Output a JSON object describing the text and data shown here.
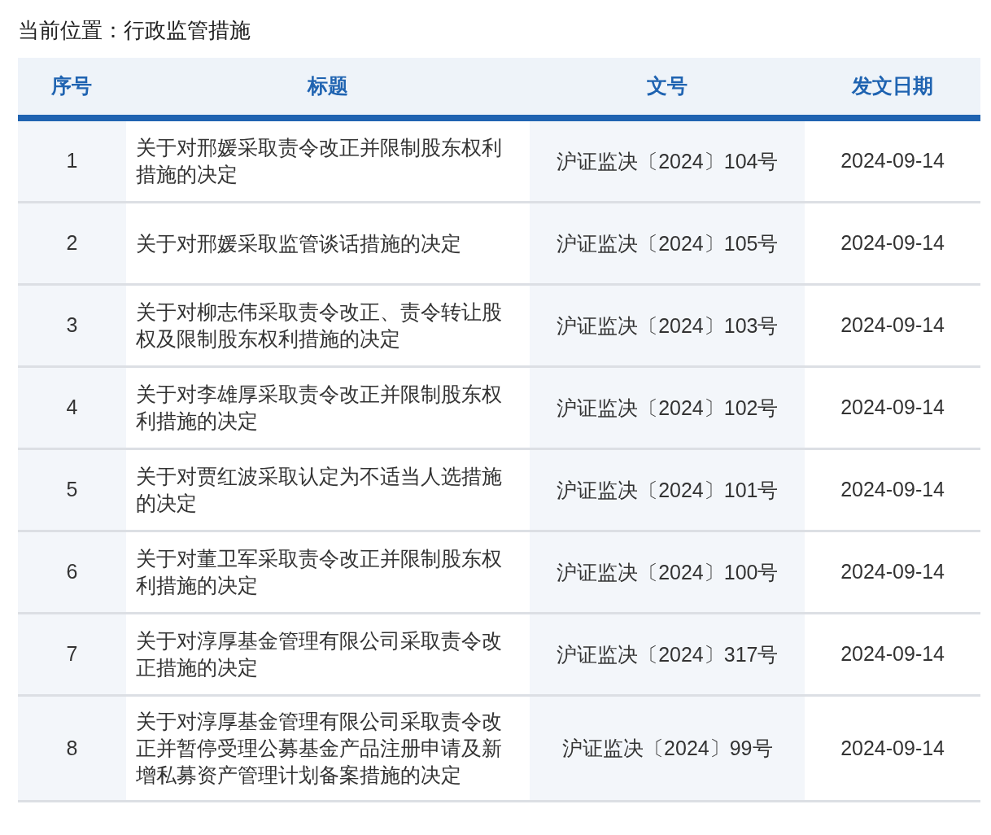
{
  "breadcrumb": "当前位置：行政监管措施",
  "table": {
    "columns": [
      "序号",
      "标题",
      "文号",
      "发文日期"
    ],
    "rows": [
      {
        "index": "1",
        "title": "关于对邢媛采取责令改正并限制股东权利措施的决定",
        "doc_no": "沪证监决〔2024〕104号",
        "date": "2024-09-14"
      },
      {
        "index": "2",
        "title": "关于对邢媛采取监管谈话措施的决定",
        "doc_no": "沪证监决〔2024〕105号",
        "date": "2024-09-14"
      },
      {
        "index": "3",
        "title": "关于对柳志伟采取责令改正、责令转让股权及限制股东权利措施的决定",
        "doc_no": "沪证监决〔2024〕103号",
        "date": "2024-09-14"
      },
      {
        "index": "4",
        "title": "关于对李雄厚采取责令改正并限制股东权利措施的决定",
        "doc_no": "沪证监决〔2024〕102号",
        "date": "2024-09-14"
      },
      {
        "index": "5",
        "title": "关于对贾红波采取认定为不适当人选措施的决定",
        "doc_no": "沪证监决〔2024〕101号",
        "date": "2024-09-14"
      },
      {
        "index": "6",
        "title": "关于对董卫军采取责令改正并限制股东权利措施的决定",
        "doc_no": "沪证监决〔2024〕100号",
        "date": "2024-09-14"
      },
      {
        "index": "7",
        "title": "关于对淳厚基金管理有限公司采取责令改正措施的决定",
        "doc_no": "沪证监决〔2024〕317号",
        "date": "2024-09-14"
      },
      {
        "index": "8",
        "title": "关于对淳厚基金管理有限公司采取责令改正并暂停受理公募基金产品注册申请及新增私募资产管理计划备案措施的决定",
        "doc_no": "沪证监决〔2024〕99号",
        "date": "2024-09-14"
      }
    ]
  }
}
